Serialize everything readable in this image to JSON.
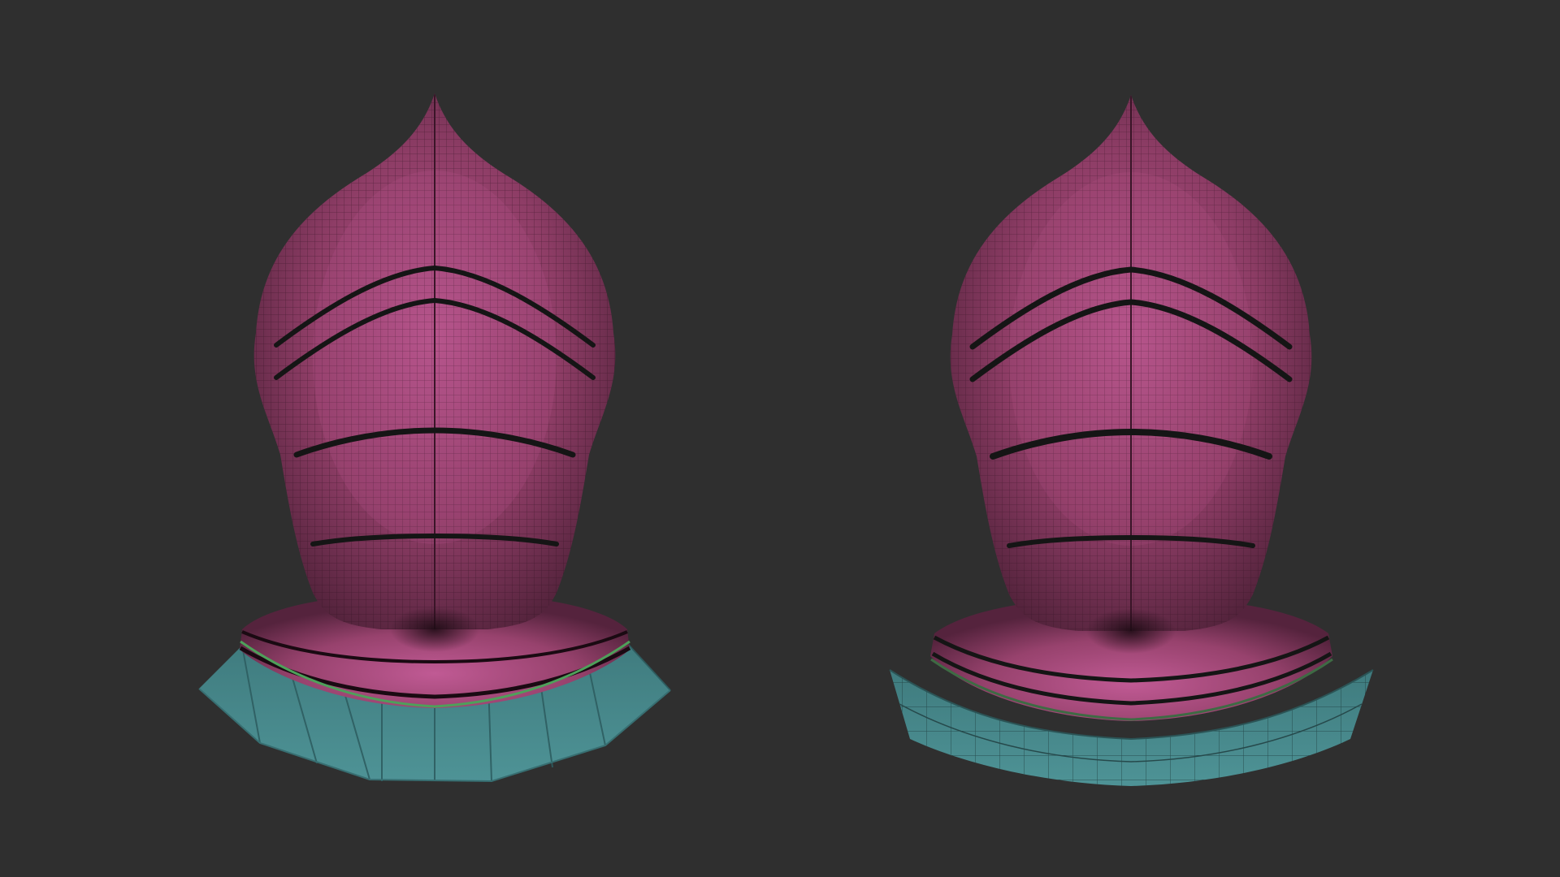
{
  "scene": {
    "background_color": "#2f2f2f",
    "models": [
      {
        "id": "helmet-low-poly-gorget",
        "helmet_color": "#8a3a62",
        "helmet_highlight": "#b8558c",
        "gorget_color": "#4a8a8c",
        "wire_color": "#1e1e1e",
        "edge_accent": "#4ea05a",
        "gorget_wireframe": false
      },
      {
        "id": "helmet-subdivided-gorget",
        "helmet_color": "#8a3a62",
        "helmet_highlight": "#b8558c",
        "gorget_color": "#4a8a8c",
        "wire_color": "#1e1e1e",
        "edge_accent": "#3e6b44",
        "gorget_wireframe": true
      }
    ]
  }
}
